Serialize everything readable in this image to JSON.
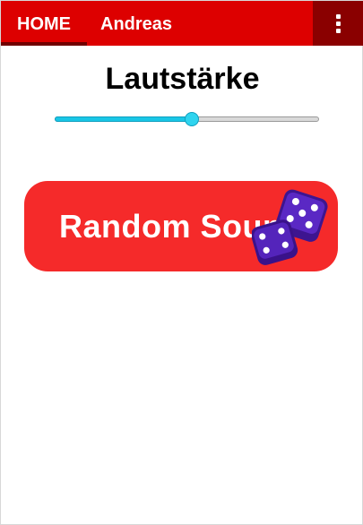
{
  "tabs": [
    {
      "label": "HOME",
      "selected": true
    },
    {
      "label": "Andreas",
      "selected": false
    }
  ],
  "menu_icon": "overflow-menu-icon",
  "title": "Lautstärke",
  "volume_slider": {
    "value": 0.52
  },
  "random_button": {
    "label": "Random Sound",
    "icon": "dice-icon"
  },
  "colors": {
    "app_bar": "#dd0000",
    "tab_indicator": "#700000",
    "menu_button_bg": "#8a0000",
    "slider_accent": "#19c6e6",
    "button": "#f52a2a",
    "dice": "#4a1aa8"
  }
}
